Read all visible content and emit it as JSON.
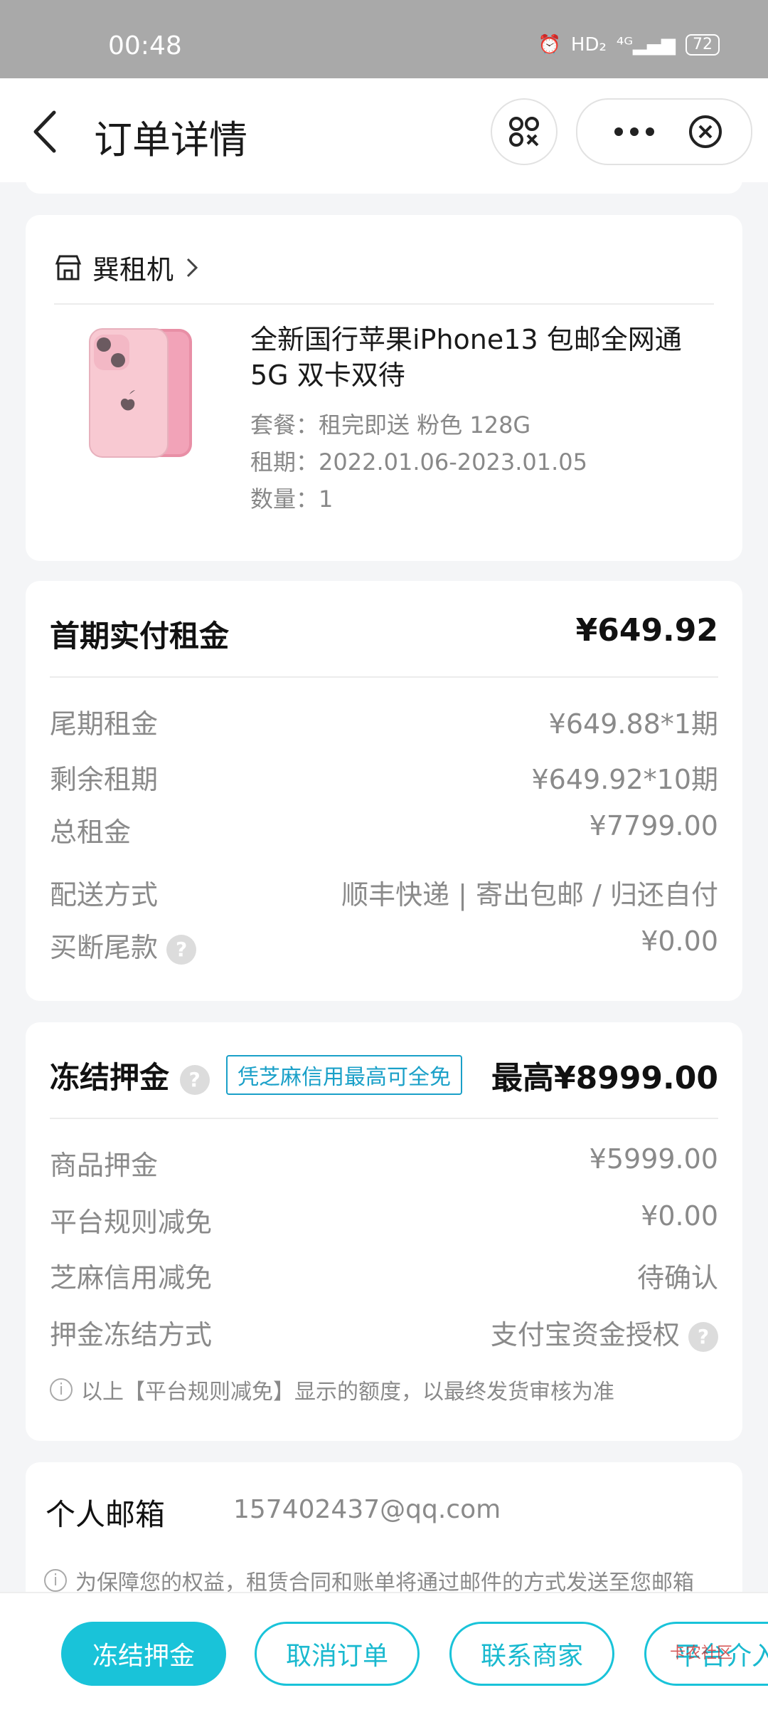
{
  "status_bar": {
    "time": "00:48",
    "network_hd": "HD₂",
    "network_signal": "⁴ᴳ",
    "battery": "72"
  },
  "nav": {
    "title": "订单详情"
  },
  "store": {
    "name": "巽租机"
  },
  "product": {
    "title": "全新国行苹果iPhone13 包邮全网通5G 双卡双待",
    "package": "套餐：租完即送 粉色 128G",
    "period": "租期：2022.01.06-2023.01.05",
    "quantity": "数量：1"
  },
  "rent": {
    "headline_label": "首期实付租金",
    "headline_value": "¥649.92",
    "rows": [
      {
        "label": "尾期租金",
        "value": "¥649.88*1期"
      },
      {
        "label": "剩余租期",
        "value": "¥649.92*10期"
      },
      {
        "label": "总租金",
        "value": "¥7799.00"
      },
      {
        "label": "配送方式",
        "value": "顺丰快递 | 寄出包邮 / 归还自付"
      },
      {
        "label": "买断尾款",
        "value": "¥0.00"
      }
    ]
  },
  "deposit": {
    "headline_label": "冻结押金",
    "badge": "凭芝麻信用最高可全免",
    "headline_value": "最高¥8999.00",
    "rows": [
      {
        "label": "商品押金",
        "value": "¥5999.00"
      },
      {
        "label": "平台规则减免",
        "value": "¥0.00"
      },
      {
        "label": "芝麻信用减免",
        "value": "待确认"
      },
      {
        "label": "押金冻结方式",
        "value": "支付宝资金授权"
      }
    ],
    "note": "以上【平台规则减免】显示的额度，以最终发货审核为准"
  },
  "email": {
    "label": "个人邮箱",
    "value": "157402437@qq.com",
    "note": "为保障您的权益，租赁合同和账单将通过邮件的方式发送至您邮箱"
  },
  "actions": {
    "freeze_deposit": "冻结押金",
    "cancel_order": "取消订单",
    "contact_merchant": "联系商家",
    "platform_intervene": "平台介入"
  },
  "watermark": "卡农社区",
  "colors": {
    "accent": "#19c3d9",
    "badge": "#1aa0c8"
  }
}
